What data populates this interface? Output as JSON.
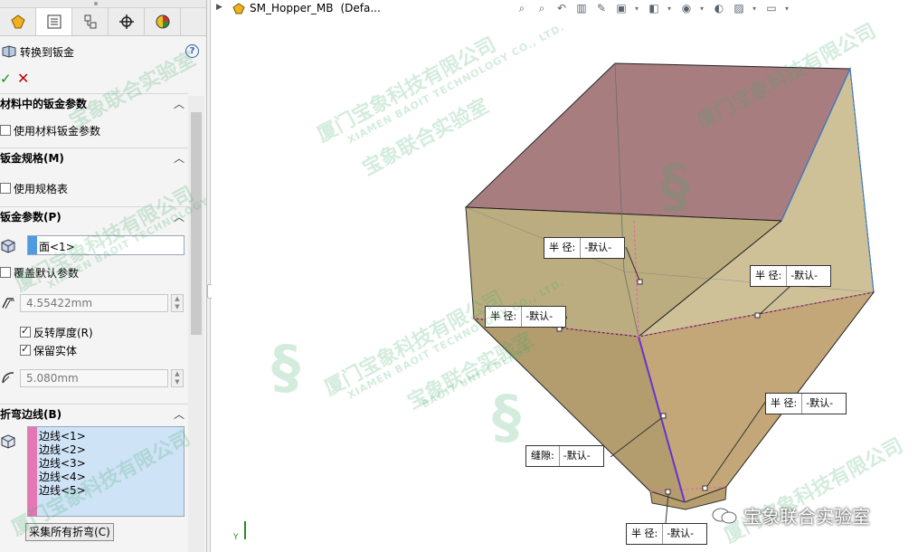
{
  "pm": {
    "title": "转换到钣金",
    "help": "?",
    "ok": "✓",
    "cancel": "✕",
    "groups": {
      "material": {
        "title": "材料中的钣金参数",
        "checkbox_label": "使用材料钣金参数",
        "checked": false
      },
      "gauge": {
        "title": "钣金规格(M)",
        "checkbox_label": "使用规格表",
        "checked": false
      },
      "params": {
        "title": "钣金参数(P)",
        "face_value": "面<1>",
        "override_label": "覆盖默认参数",
        "thickness": "4.55422mm",
        "reverse_label": "反转厚度(R)",
        "reverse_checked": true,
        "keep_body_label": "保留实体",
        "keep_body_checked": true,
        "radius": "5.080mm"
      },
      "bend_edges": {
        "title": "折弯边线(B)",
        "edges": [
          "边线<1>",
          "边线<2>",
          "边线<3>",
          "边线<4>",
          "边线<5>"
        ],
        "collect_button": "采集所有折弯(C)"
      }
    }
  },
  "viewport": {
    "document_title": "SM_Hopper_MB",
    "config": "(Defa...",
    "callouts": [
      {
        "key": "半 径:",
        "value": "-默认-"
      },
      {
        "key": "半 径:",
        "value": "-默认-"
      },
      {
        "key": "半 径:",
        "value": "-默认-"
      },
      {
        "key": "半 径:",
        "value": "-默认-"
      },
      {
        "key": "缝隙:",
        "value": "-默认-"
      },
      {
        "key": "半 径:",
        "value": "-默认-"
      }
    ],
    "watermark": {
      "line1": "厦门宝象科技有限公司",
      "line2": "XIAMEN BAOIT TECHNOLOGY CO., LTD.",
      "line3": "宝象联合实验室",
      "line4": "BAOIT UNITEDLABS"
    },
    "wechat_label": "宝象联合实验室",
    "triad_label": "Y"
  }
}
